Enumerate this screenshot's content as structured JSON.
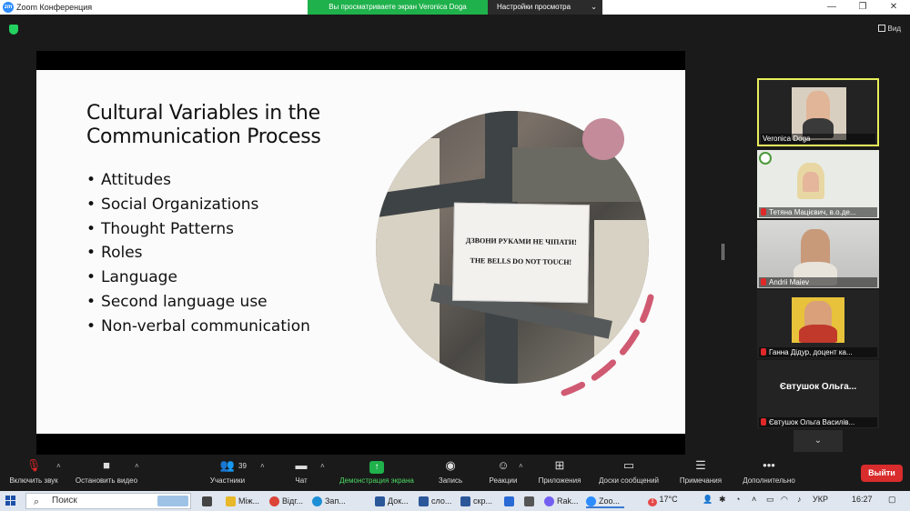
{
  "window": {
    "app_title": "Zoom Конференция",
    "zoom_logo_text": "zm",
    "share_banner": "Вы просматриваете экран Veronica Doga",
    "view_settings": "Настройки просмотра",
    "view_label": "Вид"
  },
  "slide": {
    "title_line1": "Cultural Variables in the",
    "title_line2": "Communication Process",
    "bullets": [
      "Attitudes",
      "Social Organizations",
      "Thought Patterns",
      "Roles",
      "Language",
      "Second language use",
      "Non-verbal communication"
    ],
    "sign_line1": "ДЗВОНИ РУКАМИ НЕ ЧІПАТИ!",
    "sign_line2": "THE BELLS DO NOT TOUCH!"
  },
  "participants": [
    {
      "name": "Veronica Doga",
      "muted": false,
      "active": true
    },
    {
      "name": "Тетяна Мацієвич, в.о.де...",
      "muted": true,
      "active": false
    },
    {
      "name": "Andrii Maiev",
      "muted": true,
      "active": false
    },
    {
      "name": "Ганна Дідур, доцент ка...",
      "muted": true,
      "active": false
    },
    {
      "name": "Євтушок Ольга Василів...",
      "display": "Євтушок  Ольга...",
      "muted": true,
      "active": false
    }
  ],
  "toolbar": {
    "unmute": "Включить звук",
    "start_video": "Остановить видео",
    "participants": "Участники",
    "participants_count": "39",
    "chat": "Чат",
    "share_screen": "Демонстрация экрана",
    "record": "Запись",
    "reactions": "Реакции",
    "apps": "Приложения",
    "whiteboards": "Доски сообщений",
    "notes": "Примечания",
    "more": "Дополнительно",
    "leave": "Выйти"
  },
  "taskbar": {
    "search_placeholder": "Поиск",
    "items": [
      "Між...",
      "Відг...",
      "Зап...",
      "Док...",
      "сло...",
      "скр...",
      "Rak...",
      "Zoo..."
    ],
    "weather": "17°C",
    "weather_badge": "1",
    "language": "УКР",
    "time": "16:27"
  },
  "colors": {
    "share_green": "#1fb14b",
    "leave_red": "#d92c2c",
    "active_speaker": "#e8f05a",
    "accent_pink": "#c48b9a"
  }
}
